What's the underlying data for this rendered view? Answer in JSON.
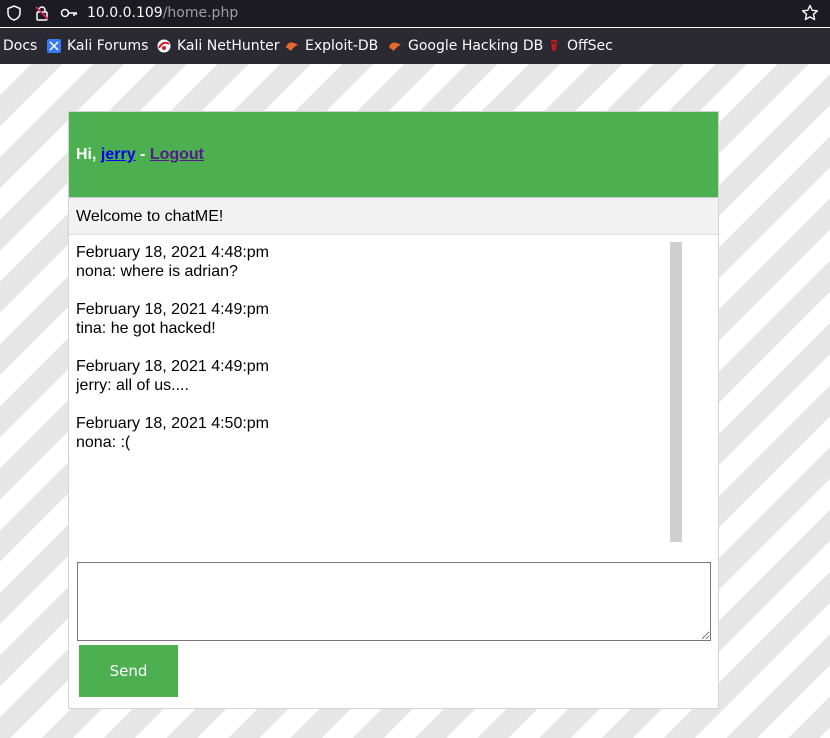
{
  "browser": {
    "url_host": "10.0.0.109",
    "url_path": "/home.php"
  },
  "bookmarks": [
    {
      "label": "Docs",
      "icon": "docs"
    },
    {
      "label": "Kali Forums",
      "icon": "kali-forums-icon"
    },
    {
      "label": "Kali NetHunter",
      "icon": "kali-nethunter-icon"
    },
    {
      "label": "Exploit-DB",
      "icon": "exploit-db-icon"
    },
    {
      "label": "Google Hacking DB",
      "icon": "ghdb-icon"
    },
    {
      "label": "OffSec",
      "icon": "offsec-icon"
    }
  ],
  "chat": {
    "greeting_prefix": "Hi, ",
    "username": "jerry",
    "separator": " - ",
    "logout_label": "Logout",
    "welcome": "Welcome to chatME!",
    "messages": [
      {
        "timestamp": "February 18, 2021 4:48:pm",
        "text": "nona: where is adrian?"
      },
      {
        "timestamp": "February 18, 2021 4:49:pm",
        "text": "tina: he got hacked!"
      },
      {
        "timestamp": "February 18, 2021 4:49:pm",
        "text": "jerry: all of us...."
      },
      {
        "timestamp": "February 18, 2021 4:50:pm",
        "text": "nona: :("
      }
    ],
    "input_value": "",
    "send_label": "Send"
  },
  "colors": {
    "header_green": "#4caf50",
    "send_green": "#4caf50"
  }
}
